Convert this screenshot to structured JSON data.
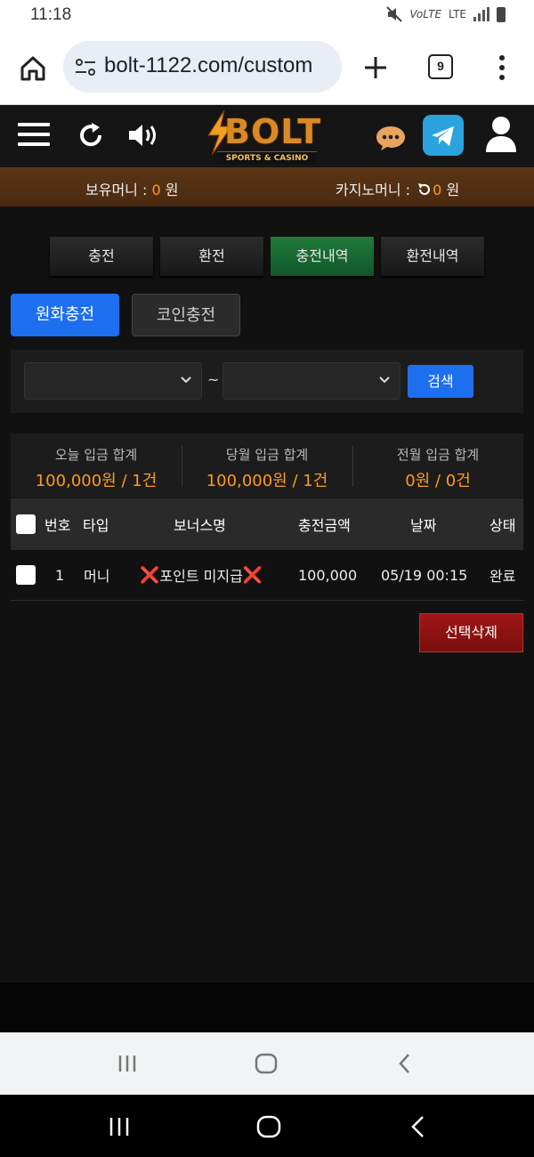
{
  "status_bar": {
    "time": "11:18",
    "network": "LTE",
    "volte": "VoLTE"
  },
  "browser": {
    "url": "bolt-1122.com/custom",
    "tab_count": "9"
  },
  "site": {
    "logo_text": "BOLT",
    "logo_subtitle": "SPORTS & CASINO"
  },
  "balance": {
    "money_label": "보유머니 : ",
    "money_value": "0",
    "money_unit": " 원",
    "casino_label": "카지노머니 : ",
    "casino_value": "0",
    "casino_unit": " 원"
  },
  "tabs": [
    {
      "label": "충전",
      "active": false
    },
    {
      "label": "환전",
      "active": false
    },
    {
      "label": "충전내역",
      "active": true
    },
    {
      "label": "환전내역",
      "active": false
    }
  ],
  "subtabs": [
    {
      "label": "원화충전",
      "active": true
    },
    {
      "label": "코인충전",
      "active": false
    }
  ],
  "search": {
    "from": "",
    "separator": "~",
    "to": "",
    "button": "검색"
  },
  "summary": [
    {
      "label": "오늘 입금 합계",
      "value": "100,000원 / 1건"
    },
    {
      "label": "당월 입금 합계",
      "value": "100,000원 / 1건"
    },
    {
      "label": "전월 입금 합계",
      "value": "0원 / 0건"
    }
  ],
  "table": {
    "headers": {
      "no": "번호",
      "type": "타입",
      "bonus": "보너스명",
      "amount": "충전금액",
      "date": "날짜",
      "status": "상태"
    },
    "rows": [
      {
        "no": "1",
        "type": "머니",
        "bonus_mark_left": "❌",
        "bonus": "포인트 미지급",
        "bonus_mark_right": "❌",
        "amount": "100,000",
        "date": "05/19 00:15",
        "status": "완료"
      }
    ]
  },
  "delete_button": "선택삭제",
  "colors": {
    "accent_blue": "#1e6ff0",
    "accent_orange": "#ff9a1f",
    "active_tab_green": "#1f7a3a",
    "danger_red": "#a01616"
  },
  "icons": [
    "home-icon",
    "tune-icon",
    "plus-icon",
    "tabs-icon",
    "more-icon",
    "menu-icon",
    "refresh-icon",
    "speaker-icon",
    "chat-icon",
    "telegram-icon",
    "user-icon",
    "chevron-down-icon",
    "recent-apps-icon",
    "home-circle-icon",
    "back-icon"
  ]
}
